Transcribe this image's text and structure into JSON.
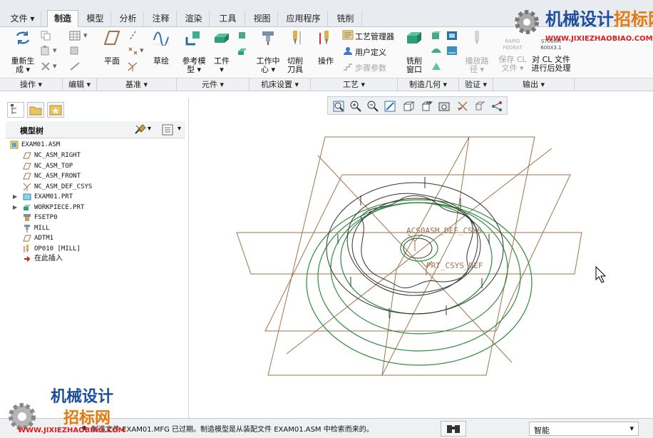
{
  "tabs": [
    "文件",
    "制造",
    "模型",
    "分析",
    "注释",
    "渲染",
    "工具",
    "视图",
    "应用程序",
    "铣削"
  ],
  "ribbon": {
    "regen": "重新生",
    "regen2": "成",
    "plane": "平面",
    "sketch": "草绘",
    "refmodel": "参考模",
    "refmodel2": "型",
    "workpiece": "工件",
    "workcenter": "工作中",
    "workcenter2": "心",
    "cutter": "切削",
    "cutter2": "刀具",
    "operation": "操作",
    "process_mgr": "工艺管理器",
    "user_def": "用户定义",
    "step_param": "步骤参数",
    "mill_window": "铣削",
    "mill_window2": "窗口",
    "play_path": "播放路",
    "play_path2": "径",
    "save_cl": "保存 CL",
    "save_cl2": "文件",
    "post": "对 CL 文件",
    "post2": "进行后处理",
    "rapid": "RAPID",
    "fedrat": "FEDRAT",
    "s7000": "S7000M",
    "g600": "600X3.1"
  },
  "groups": [
    "操作 ▾",
    "编辑 ▾",
    "基准 ▾",
    "元件 ▾",
    "机床设置 ▾",
    "工艺 ▾",
    "制造几何 ▾",
    "验证 ▾",
    "输出 ▾"
  ],
  "tree": {
    "title": "模型树",
    "items": [
      {
        "label": "EXAM01.ASM",
        "icon": "assembly-icon"
      },
      {
        "label": "NC_ASM_RIGHT",
        "icon": "datum-plane-icon"
      },
      {
        "label": "NC_ASM_TOP",
        "icon": "datum-plane-icon"
      },
      {
        "label": "NC_ASM_FRONT",
        "icon": "datum-plane-icon"
      },
      {
        "label": "NC_ASM_DEF_CSYS",
        "icon": "csys-icon"
      },
      {
        "label": "EXAM01.PRT",
        "icon": "part-icon"
      },
      {
        "label": "WORKPIECE.PRT",
        "icon": "workpiece-icon"
      },
      {
        "label": "FSETP0",
        "icon": "fixture-icon"
      },
      {
        "label": "MILL",
        "icon": "mill-icon"
      },
      {
        "label": "ADTM1",
        "icon": "datum-plane-icon"
      },
      {
        "label": "OP010 [MILL]",
        "icon": "operation-icon"
      },
      {
        "label": "在此插入",
        "icon": "insert-arrow-icon"
      }
    ]
  },
  "viewport": {
    "csys1": "ACS0ASM_DEF_CSYS",
    "csys2": "PRT_CSYS_DEF"
  },
  "status": {
    "message": "制造文件 EXAM01.MFG 已过期。制造模型是从装配文件 EXAM01.ASM 中检索而来的。",
    "filter": "智能"
  },
  "watermark": {
    "title": "机械设计",
    "title2": "招标网",
    "url": "WWW.JIXIEZHAOBIAO.COM"
  },
  "colors": {
    "accent": "#2f6fb3",
    "workpiece": "#a0724a",
    "toolpath": "#2e8b3e",
    "watermark_blue": "#1b4f9c",
    "watermark_orange": "#e27a10"
  }
}
